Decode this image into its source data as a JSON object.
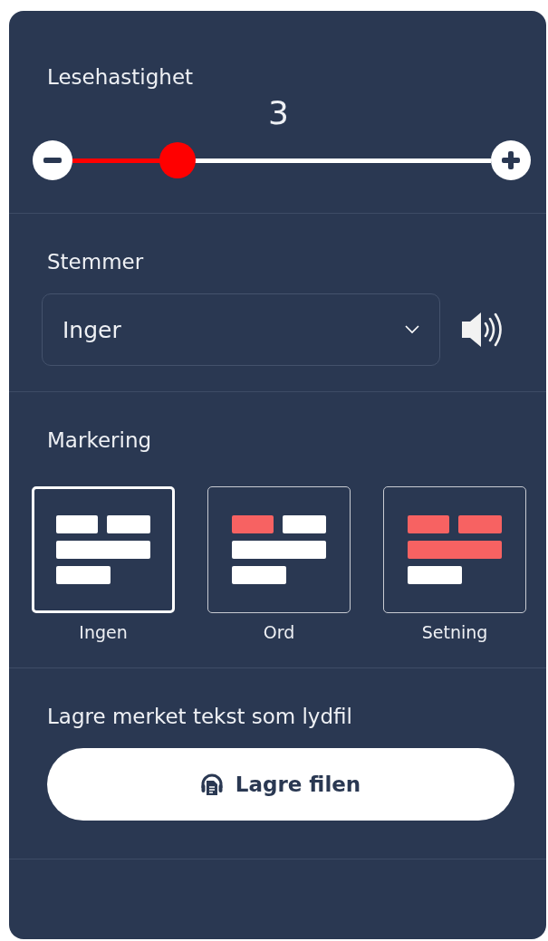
{
  "reading_speed": {
    "heading": "Lesehastighet",
    "value": "3",
    "level": 0.25
  },
  "voices": {
    "heading": "Stemmer",
    "value": "Inger"
  },
  "marking": {
    "heading": "Markering",
    "options": [
      {
        "label": "Ingen",
        "kind": "none",
        "selected": true
      },
      {
        "label": "Ord",
        "kind": "word",
        "selected": false
      },
      {
        "label": "Setning",
        "kind": "sentence",
        "selected": false
      }
    ]
  },
  "save": {
    "heading": "Lagre merket tekst som lydfil",
    "button": "Lagre filen"
  }
}
